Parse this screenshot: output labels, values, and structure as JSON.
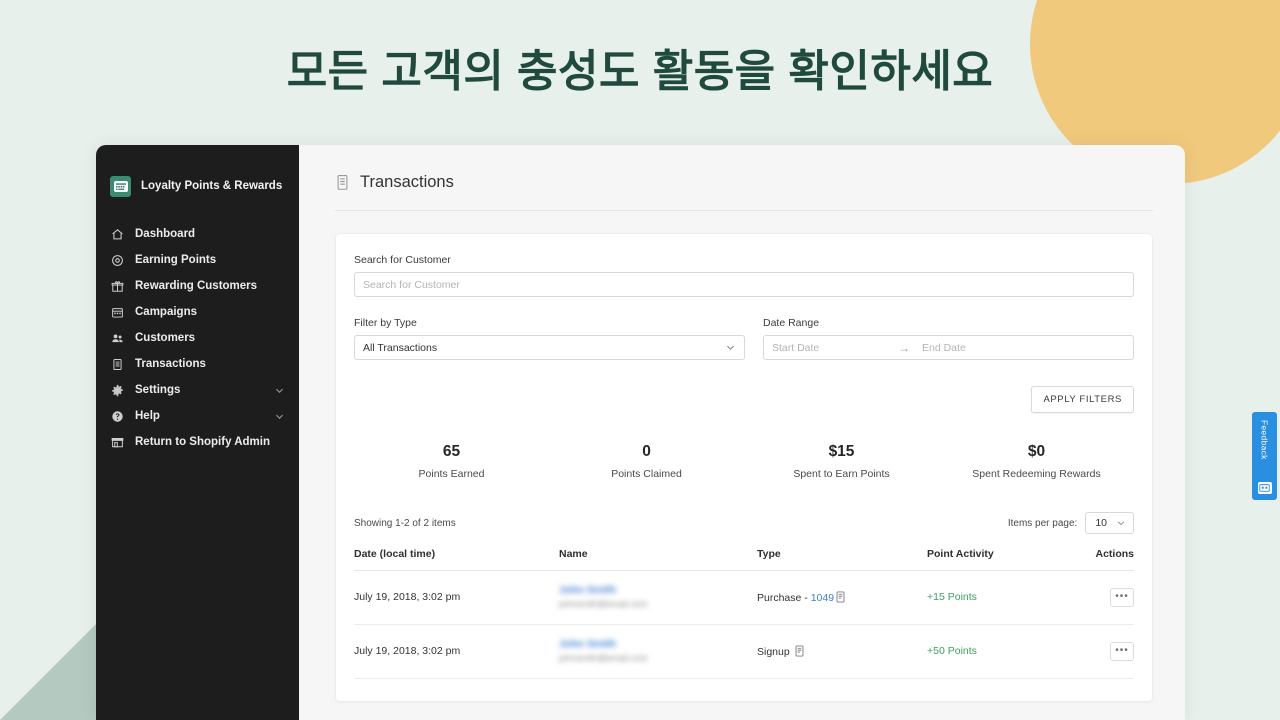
{
  "hero": {
    "title": "모든 고객의 충성도 활동을 확인하세요"
  },
  "colors": {
    "page_background": "#e8f0ec",
    "title_color": "#1f4a3d",
    "corner_circle": "#f1c97d",
    "corner_triangle": "#b4c9bf",
    "sidebar_background": "#1d1d1d",
    "brand_accent": "#3c8a72",
    "link_blue": "#3d7fd1",
    "points_green": "#3d9e62",
    "feedback_blue": "#2a8fe0"
  },
  "sidebar": {
    "brand_name": "Loyalty Points & Rewards",
    "brand_logo_icon": "loyalty-card-icon",
    "items": [
      {
        "label": "Dashboard",
        "icon": "home-icon",
        "has_chevron": false
      },
      {
        "label": "Earning Points",
        "icon": "target-icon",
        "has_chevron": false
      },
      {
        "label": "Rewarding Customers",
        "icon": "gift-icon",
        "has_chevron": false
      },
      {
        "label": "Campaigns",
        "icon": "calendar-icon",
        "has_chevron": false
      },
      {
        "label": "Customers",
        "icon": "people-icon",
        "has_chevron": false
      },
      {
        "label": "Transactions",
        "icon": "list-document-icon",
        "has_chevron": false
      },
      {
        "label": "Settings",
        "icon": "gear-icon",
        "has_chevron": true
      },
      {
        "label": "Help",
        "icon": "question-circle-icon",
        "has_chevron": true
      },
      {
        "label": "Return to Shopify Admin",
        "icon": "storefront-icon",
        "has_chevron": false
      }
    ]
  },
  "page": {
    "title": "Transactions",
    "title_icon": "list-document-icon"
  },
  "filters": {
    "search_label": "Search for Customer",
    "search_value": "",
    "search_placeholder": "Search for Customer",
    "type_label": "Filter by Type",
    "type_value": "All Transactions",
    "type_options": [
      "All Transactions"
    ],
    "date_label": "Date Range",
    "start_date_value": "",
    "start_date_placeholder": "Start Date",
    "date_separator": "→",
    "end_date_value": "",
    "end_date_placeholder": "End Date",
    "apply_label": "APPLY FILTERS"
  },
  "stats": [
    {
      "value": "65",
      "label": "Points Earned"
    },
    {
      "value": "0",
      "label": "Points Claimed"
    },
    {
      "value": "$15",
      "label": "Spent to Earn Points"
    },
    {
      "value": "$0",
      "label": "Spent Redeeming Rewards"
    }
  ],
  "table_meta": {
    "showing": "Showing 1-2 of 2 items",
    "per_page_label": "Items per page:",
    "per_page_value": "10",
    "per_page_options": [
      "10"
    ]
  },
  "table": {
    "columns": [
      "Date (local time)",
      "Name",
      "Type",
      "Point Activity",
      "Actions"
    ],
    "rows": [
      {
        "date": "July 19, 2018, 3:02 pm",
        "name": "John Smith",
        "email": "johnsmith@email.com",
        "type_prefix": "Purchase - ",
        "type_link": "1049",
        "type_note_icon": "note-icon",
        "points": "+15 Points",
        "action_label": "•••"
      },
      {
        "date": "July 19, 2018, 3:02 pm",
        "name": "John Smith",
        "email": "johnsmith@email.com",
        "type_prefix": "Signup ",
        "type_link": "",
        "type_note_icon": "note-icon",
        "points": "+50 Points",
        "action_label": "•••"
      }
    ]
  },
  "feedback": {
    "label": "Feedback",
    "icon": "chat-feedback-icon"
  }
}
